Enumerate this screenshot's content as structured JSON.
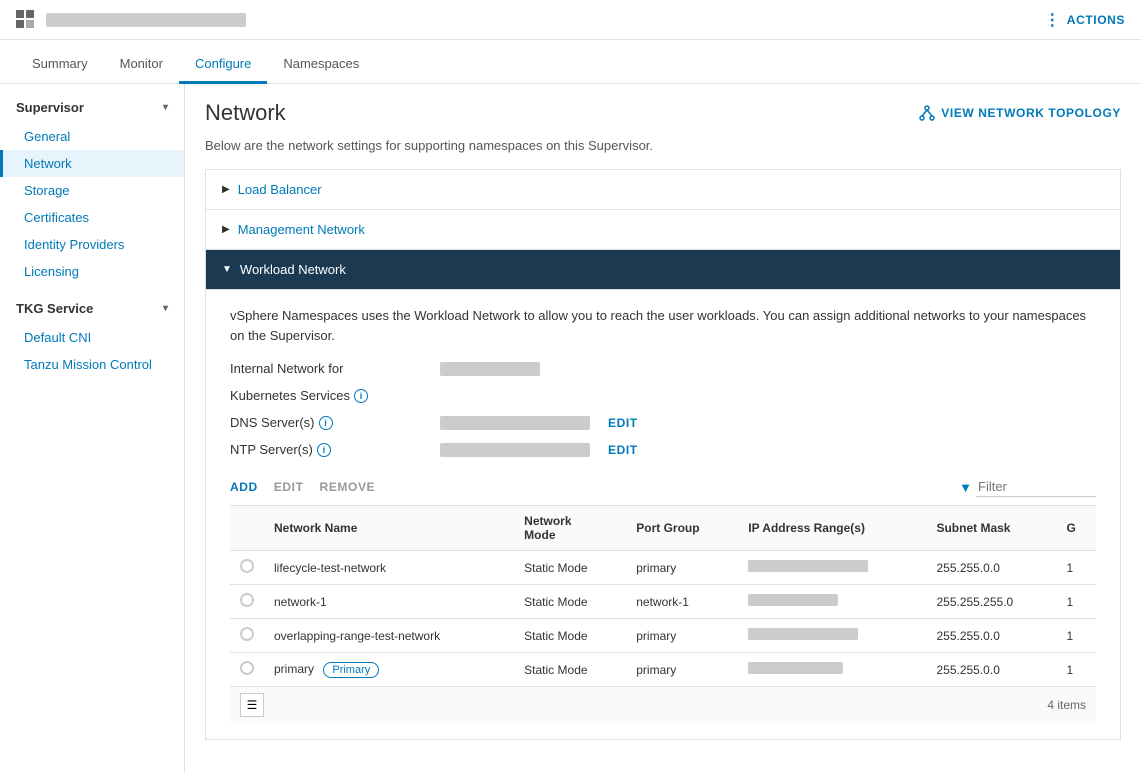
{
  "topBar": {
    "actionsLabel": "ACTIONS"
  },
  "navTabs": {
    "tabs": [
      {
        "id": "summary",
        "label": "Summary"
      },
      {
        "id": "monitor",
        "label": "Monitor"
      },
      {
        "id": "configure",
        "label": "Configure"
      },
      {
        "id": "namespaces",
        "label": "Namespaces"
      }
    ],
    "activeTab": "configure"
  },
  "sidebar": {
    "supervisor": {
      "label": "Supervisor",
      "items": [
        {
          "id": "general",
          "label": "General"
        },
        {
          "id": "network",
          "label": "Network",
          "active": true
        },
        {
          "id": "storage",
          "label": "Storage"
        },
        {
          "id": "certificates",
          "label": "Certificates"
        },
        {
          "id": "identity-providers",
          "label": "Identity Providers"
        },
        {
          "id": "licensing",
          "label": "Licensing"
        }
      ]
    },
    "tkgService": {
      "label": "TKG Service",
      "items": [
        {
          "id": "default-cni",
          "label": "Default CNI"
        },
        {
          "id": "tanzu-mission-control",
          "label": "Tanzu Mission Control"
        }
      ]
    }
  },
  "content": {
    "pageTitle": "Network",
    "viewTopologyLabel": "VIEW NETWORK TOPOLOGY",
    "description": "Below are the network settings for supporting namespaces on this Supervisor.",
    "accordion": {
      "sections": [
        {
          "id": "load-balancer",
          "label": "Load Balancer",
          "expanded": false
        },
        {
          "id": "management-network",
          "label": "Management Network",
          "expanded": false
        },
        {
          "id": "workload-network",
          "label": "Workload Network",
          "expanded": true
        }
      ]
    },
    "workload": {
      "description": "vSphere Namespaces uses the Workload Network to allow you to reach the user workloads. You can assign additional networks to your namespaces on the Supervisor.",
      "internalNetworkLabel": "Internal Network for",
      "kubernetesServicesLabel": "Kubernetes Services",
      "dnsServersLabel": "DNS Server(s)",
      "ntpServersLabel": "NTP Server(s)",
      "editLabel": "EDIT"
    },
    "tableToolbar": {
      "addLabel": "ADD",
      "editLabel": "EDIT",
      "removeLabel": "REMOVE",
      "filterPlaceholder": "Filter"
    },
    "table": {
      "columns": [
        {
          "id": "select",
          "label": ""
        },
        {
          "id": "network-name",
          "label": "Network Name"
        },
        {
          "id": "network-mode",
          "label": "Network Mode"
        },
        {
          "id": "port-group",
          "label": "Port Group"
        },
        {
          "id": "ip-address-ranges",
          "label": "IP Address Range(s)"
        },
        {
          "id": "subnet-mask",
          "label": "Subnet Mask"
        },
        {
          "id": "g",
          "label": "G"
        }
      ],
      "rows": [
        {
          "id": "row-1",
          "name": "lifecycle-test-network",
          "mode": "Static Mode",
          "portGroup": "primary",
          "subnetMask": "255.255.0.0",
          "suffix": "1",
          "ipBarWidth": 120
        },
        {
          "id": "row-2",
          "name": "network-1",
          "mode": "Static Mode",
          "portGroup": "network-1",
          "subnetMask": "255.255.255.0",
          "suffix": "1",
          "ipBarWidth": 90
        },
        {
          "id": "row-3",
          "name": "overlapping-range-test-network",
          "mode": "Static Mode",
          "portGroup": "primary",
          "subnetMask": "255.255.0.0",
          "suffix": "1",
          "ipBarWidth": 110
        },
        {
          "id": "row-4",
          "name": "primary",
          "badge": "Primary",
          "mode": "Static Mode",
          "portGroup": "primary",
          "subnetMask": "255.255.0.0",
          "suffix": "1",
          "ipBarWidth": 95
        }
      ],
      "footer": {
        "itemCount": "4 items"
      }
    }
  }
}
